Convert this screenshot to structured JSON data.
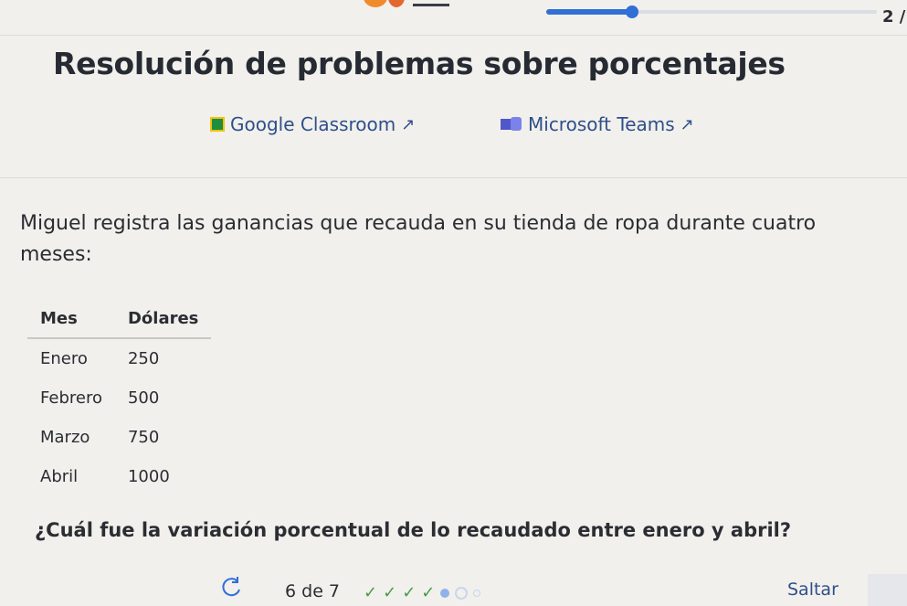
{
  "header": {
    "page_number": "2 /",
    "progress_fraction": 0.26
  },
  "title": "Resolución de problemas sobre porcentajes",
  "share": {
    "google_classroom": "Google Classroom",
    "microsoft_teams": "Microsoft Teams",
    "external_icon": "↗"
  },
  "problem": {
    "text": "Miguel registra las ganancias que recauda en su tienda de ropa durante cuatro meses:",
    "table": {
      "headers": [
        "Mes",
        "Dólares"
      ],
      "rows": [
        [
          "Enero",
          "250"
        ],
        [
          "Febrero",
          "500"
        ],
        [
          "Marzo",
          "750"
        ],
        [
          "Abril",
          "1000"
        ]
      ]
    },
    "question": "¿Cuál fue la variación porcentual de lo recaudado entre enero y abril?"
  },
  "footer": {
    "counter": "6 de 7",
    "checks": [
      "✓",
      "✓",
      "✓",
      "✓"
    ],
    "skip": "Saltar",
    "icons": [
      "retry-icon",
      "check-icon"
    ]
  },
  "colors": {
    "accent": "#2f6fd6",
    "link": "#2f4f8a",
    "success": "#4a9a4a"
  }
}
